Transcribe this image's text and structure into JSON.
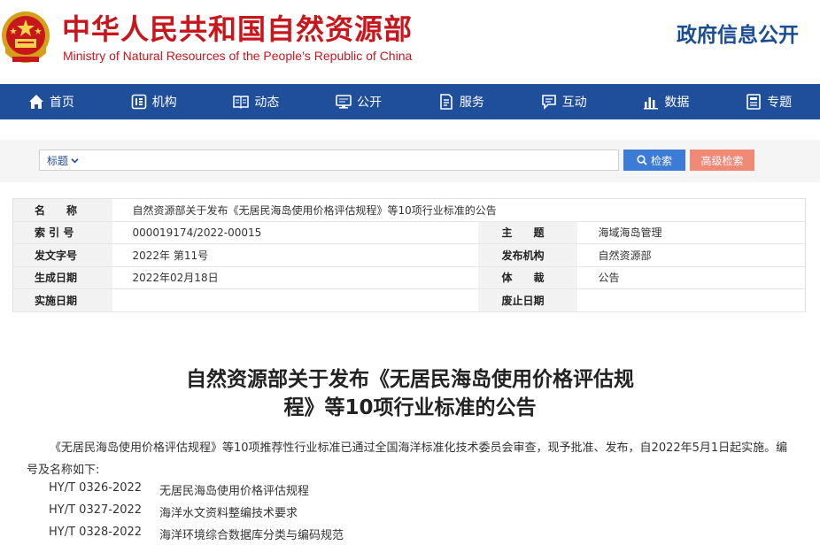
{
  "header": {
    "title": "中华人民共和国自然资源部",
    "subtitle": "Ministry of Natural Resources of the People’s Republic of China",
    "right_title": "政府信息公开",
    "emblem_icon": "national-emblem-icon"
  },
  "nav": {
    "items": [
      {
        "label": "首页",
        "icon": "home-icon"
      },
      {
        "label": "机构",
        "icon": "org-icon"
      },
      {
        "label": "动态",
        "icon": "book-icon"
      },
      {
        "label": "公开",
        "icon": "monitor-icon"
      },
      {
        "label": "服务",
        "icon": "document-icon"
      },
      {
        "label": "互动",
        "icon": "chat-icon"
      },
      {
        "label": "数据",
        "icon": "bar-chart-icon"
      },
      {
        "label": "专题",
        "icon": "topic-icon"
      }
    ],
    "bg_color": "#1f4e9a"
  },
  "search": {
    "type_label": "标题",
    "value": "",
    "search_label": "检索",
    "advanced_label": "高级检索"
  },
  "info": {
    "name_label": "名　　称",
    "name_value": "自然资源部关于发布《无居民海岛使用价格评估规程》等10项行业标准的公告",
    "index_label": "索 引 号",
    "index_value": "000019174/2022-00015",
    "topic_label": "主　　题",
    "topic_value": "海域海岛管理",
    "docno_label": "发文字号",
    "docno_value": "2022年 第11号",
    "issuer_label": "发布机构",
    "issuer_value": "自然资源部",
    "date_label": "生成日期",
    "date_value": "2022年02月18日",
    "genre_label": "体　　裁",
    "genre_value": "公告",
    "impl_label": "实施日期",
    "impl_value": "",
    "abolish_label": "废止日期",
    "abolish_value": ""
  },
  "article": {
    "title_line1": "自然资源部关于发布《无居民海岛使用价格评估规",
    "title_line2": "程》等10项行业标准的公告",
    "paragraph": "《无居民海岛使用价格评估规程》等10项推荐性行业标准已通过全国海洋标准化技术委员会审查，现予批准、发布，自2022年5月1日起实施。编号及名称如下:",
    "standards": [
      {
        "code": "HY/T 0326-2022",
        "name": "无居民海岛使用价格评估规程"
      },
      {
        "code": "HY/T 0327-2022",
        "name": "海洋水文资料整编技术要求"
      },
      {
        "code": "HY/T 0328-2022",
        "name": "海洋环境综合数据库分类与编码规范"
      }
    ]
  }
}
